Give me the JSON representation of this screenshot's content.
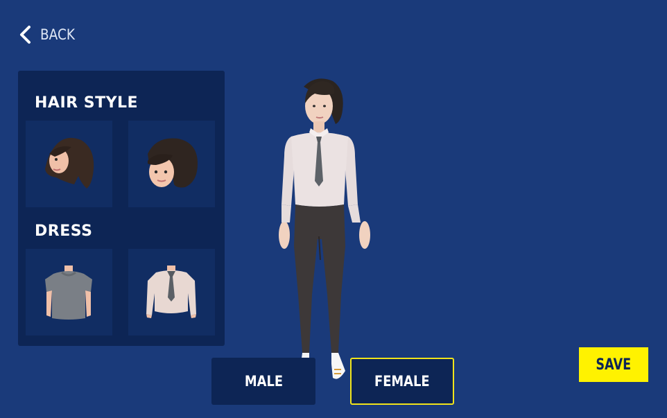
{
  "nav": {
    "back_label": "BACK"
  },
  "panel": {
    "hair_title": "HAIR STYLE",
    "dress_title": "DRESS",
    "hair_options": [
      "long-dark-hair",
      "bob-dark-hair"
    ],
    "dress_options": [
      "gray-tshirt",
      "white-shirt-with-tie"
    ]
  },
  "gender": {
    "male_label": "MALE",
    "female_label": "FEMALE",
    "selected": "FEMALE"
  },
  "actions": {
    "save_label": "SAVE"
  },
  "colors": {
    "background": "#1a3a7a",
    "panel": "#0d2555",
    "tile": "#112d63",
    "highlight": "#f2e51a",
    "save_button": "#fff200"
  }
}
